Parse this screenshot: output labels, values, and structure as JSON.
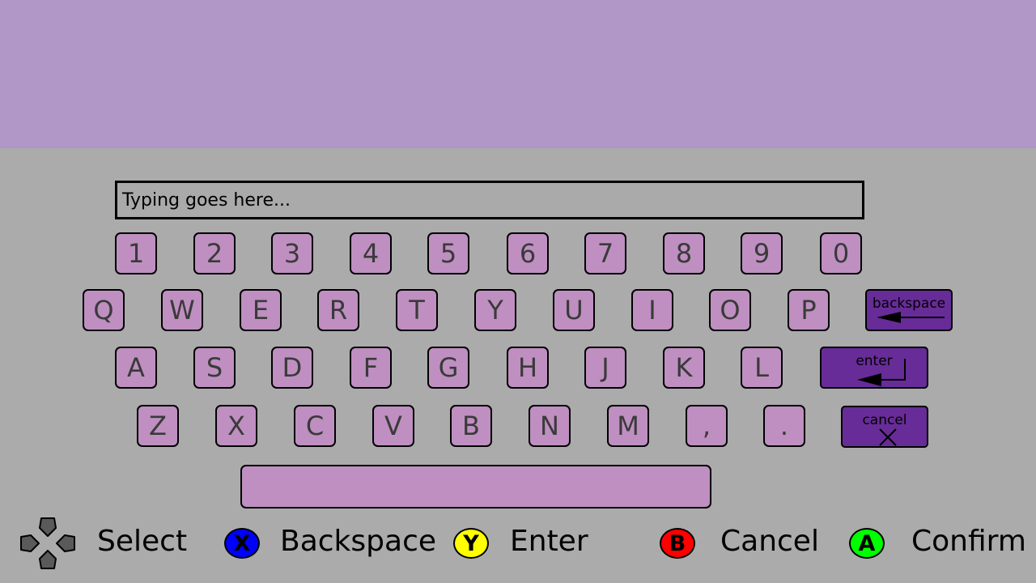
{
  "input": {
    "placeholder": "Typing goes here..."
  },
  "keyboard": {
    "row_numbers": [
      "1",
      "2",
      "3",
      "4",
      "5",
      "6",
      "7",
      "8",
      "9",
      "0"
    ],
    "row_qwerty": [
      "Q",
      "W",
      "E",
      "R",
      "T",
      "Y",
      "U",
      "I",
      "O",
      "P"
    ],
    "row_asdf": [
      "A",
      "S",
      "D",
      "F",
      "G",
      "H",
      "J",
      "K",
      "L"
    ],
    "row_zxcv": [
      "Z",
      "X",
      "C",
      "V",
      "B",
      "N",
      "M",
      ",",
      "."
    ],
    "backspace_label": "backspace",
    "enter_label": "enter",
    "cancel_label": "cancel"
  },
  "legend": {
    "select": {
      "icon": "dpad-icon",
      "label": "Select"
    },
    "backspace": {
      "button": "X",
      "color": "#0000ff",
      "label": "Backspace"
    },
    "enter": {
      "button": "Y",
      "color": "#ffff00",
      "label": "Enter"
    },
    "cancel": {
      "button": "B",
      "color": "#ff0000",
      "label": "Cancel"
    },
    "confirm": {
      "button": "A",
      "color": "#00ff00",
      "label": "Confirm"
    }
  },
  "colors": {
    "top_band": "#b196c8",
    "background": "#ababab",
    "key_fill": "#bf8fc1",
    "special_key_fill": "#672c98"
  }
}
